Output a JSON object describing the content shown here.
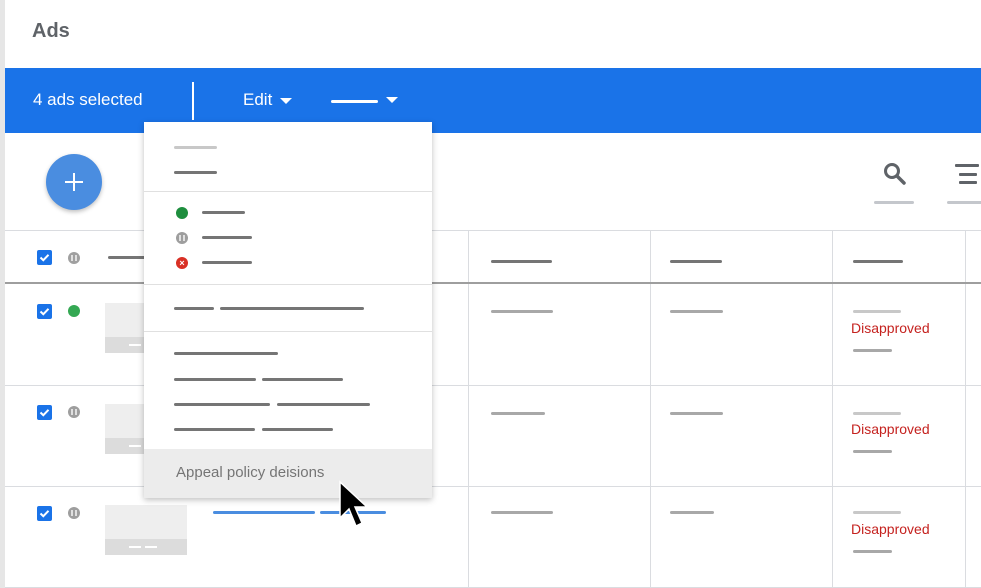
{
  "page": {
    "title": "Ads"
  },
  "selection_bar": {
    "count_label": "4 ads selected",
    "edit_label": "Edit",
    "more_menu_label": ""
  },
  "toolbar": {
    "add_icon": "plus-icon",
    "search_icon": "search-icon",
    "filter_icon": "filter-icon"
  },
  "dropdown": {
    "sections": [
      {
        "items": [
          "",
          ""
        ]
      },
      {
        "items": [
          {
            "icon": "enabled-status-icon",
            "color": "#1e8e3e",
            "label": ""
          },
          {
            "icon": "paused-status-icon",
            "color": "#9e9e9e",
            "label": ""
          },
          {
            "icon": "removed-status-icon",
            "color": "#d93025",
            "label": ""
          }
        ]
      },
      {
        "items": [
          ""
        ]
      },
      {
        "items": [
          "",
          "",
          "",
          ""
        ]
      }
    ],
    "highlighted_item": "Appeal policy deisions"
  },
  "table": {
    "rows": [
      {
        "checked": true,
        "status": "enabled",
        "status_color": "#34a853",
        "policy_status": "Disapproved"
      },
      {
        "checked": true,
        "status": "paused",
        "status_color": "#9e9e9e",
        "policy_status": "Disapproved"
      },
      {
        "checked": true,
        "status": "paused",
        "status_color": "#9e9e9e",
        "policy_status": "Disapproved"
      }
    ],
    "header_checked": true
  },
  "colors": {
    "accent": "#1a73e8",
    "disapproved": "#c5221f"
  }
}
